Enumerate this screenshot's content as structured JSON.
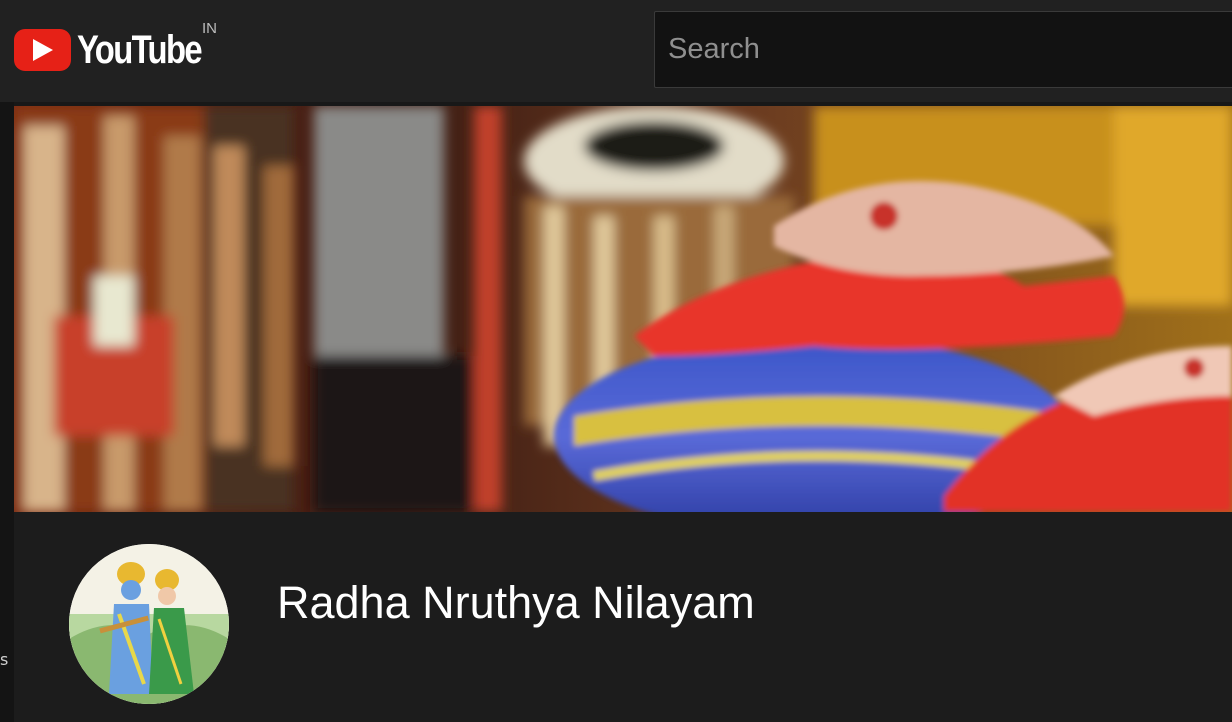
{
  "masthead": {
    "logo_text": "YouTube",
    "region_code": "IN",
    "search": {
      "placeholder": "Search",
      "value": ""
    }
  },
  "left_strip": {
    "partial_text": "s"
  },
  "banner": {
    "description_icon": "banner-image"
  },
  "channel": {
    "name": "Radha Nruthya Nilayam",
    "avatar_icon": "channel-avatar"
  },
  "colors": {
    "background": "#181818",
    "masthead": "#212121",
    "brand_red": "#e62117",
    "text": "#ffffff"
  }
}
